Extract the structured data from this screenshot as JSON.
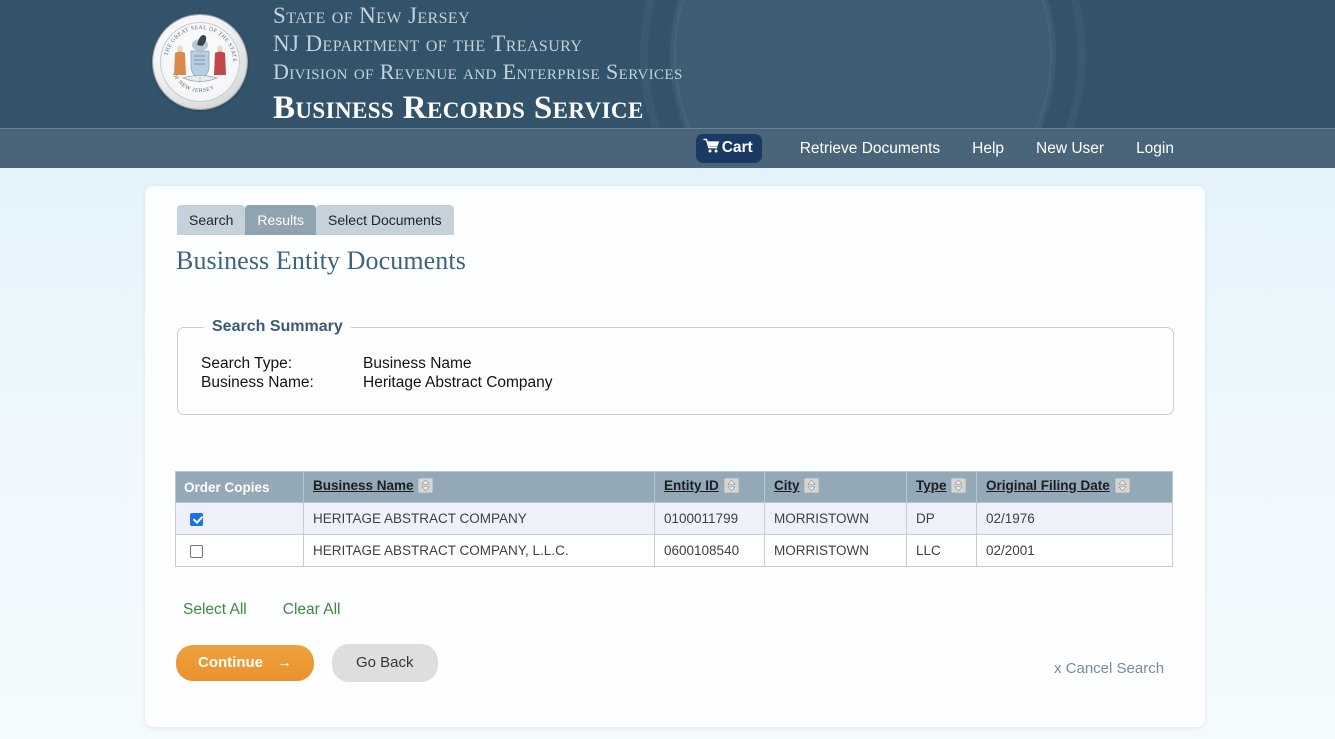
{
  "masthead": {
    "seal_alt": "state-seal-of-new-jersey",
    "line1": "State of New Jersey",
    "line2": "NJ Department of the Treasury",
    "line3": "Division of Revenue and Enterprise Services",
    "line4": "Business Records Service"
  },
  "nav": {
    "cart_label": "Cart",
    "links": [
      {
        "label": "Retrieve Documents"
      },
      {
        "label": "Help"
      },
      {
        "label": "New User"
      },
      {
        "label": "Login"
      }
    ]
  },
  "tabs": [
    {
      "label": "Search",
      "active": false
    },
    {
      "label": "Results",
      "active": true
    },
    {
      "label": "Select Documents",
      "active": false
    }
  ],
  "page_title": "Business Entity Documents",
  "search_summary": {
    "legend": "Search Summary",
    "rows": [
      {
        "label": "Search Type:",
        "value": "Business Name"
      },
      {
        "label": "Business Name:",
        "value": "Heritage Abstract Company"
      }
    ]
  },
  "results": {
    "columns": [
      {
        "label": "Order Copies",
        "sortable": false
      },
      {
        "label": "Business Name",
        "sortable": true
      },
      {
        "label": "Entity ID",
        "sortable": true
      },
      {
        "label": "City",
        "sortable": true
      },
      {
        "label": "Type",
        "sortable": true
      },
      {
        "label": "Original Filing Date",
        "sortable": true
      }
    ],
    "rows": [
      {
        "checked": true,
        "business_name": "HERITAGE ABSTRACT COMPANY",
        "entity_id": "0100011799",
        "city": "MORRISTOWN",
        "type": "DP",
        "original_filing_date": "02/1976"
      },
      {
        "checked": false,
        "business_name": "HERITAGE ABSTRACT COMPANY, L.L.C.",
        "entity_id": "0600108540",
        "city": "MORRISTOWN",
        "type": "LLC",
        "original_filing_date": "02/2001"
      }
    ]
  },
  "actions": {
    "select_all": "Select All",
    "clear_all": "Clear All",
    "continue": "Continue",
    "continue_arrow": "→",
    "go_back": "Go Back",
    "cancel_search": "x Cancel Search"
  },
  "colors": {
    "masthead_bg": "#33536a",
    "navbar_bg": "#4a6579",
    "cart_bg": "#1b3a63",
    "tab_bg": "#c6d2da",
    "tab_active_bg": "#8fa3b0",
    "title_text": "#3d6382",
    "table_header_bg": "#93a9b7",
    "selected_row_bg": "#eef0fa",
    "checkbox_checked": "#1a73e8",
    "green_link": "#3f8a3f",
    "continue_button": "#e8922d",
    "go_back_button": "#dedede"
  }
}
